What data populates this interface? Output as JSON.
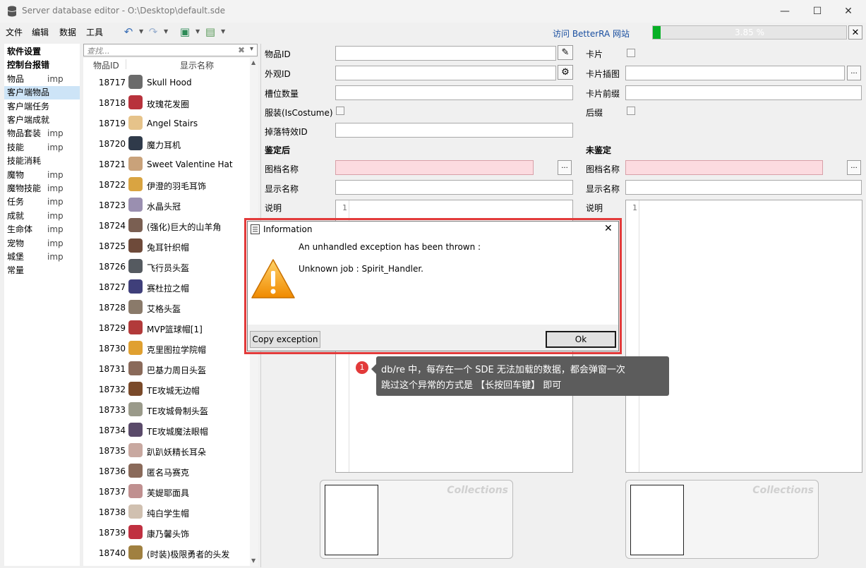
{
  "window": {
    "title": "Server database editor - O:\\Desktop\\default.sde",
    "minimize": "—",
    "maximize": "☐",
    "close": "✕"
  },
  "menu": [
    "文件",
    "编辑",
    "数据",
    "工具"
  ],
  "toolbar": {
    "visit_link": "访问 BetterRA 网站",
    "progress_text": "3.85 %",
    "progress_value": 0.0385,
    "progress_close": "✕"
  },
  "nav": [
    {
      "label": "软件设置",
      "suffix": "",
      "bold": true
    },
    {
      "label": "控制台报错",
      "suffix": "",
      "bold": true
    },
    {
      "label": "物品",
      "suffix": "imp"
    },
    {
      "label": "客户端物品",
      "suffix": "",
      "selected": true
    },
    {
      "label": "客户端任务",
      "suffix": ""
    },
    {
      "label": "客户端成就",
      "suffix": ""
    },
    {
      "label": "物品套装",
      "suffix": "imp"
    },
    {
      "label": "技能",
      "suffix": "imp"
    },
    {
      "label": "技能消耗",
      "suffix": ""
    },
    {
      "label": "魔物",
      "suffix": "imp"
    },
    {
      "label": "魔物技能",
      "suffix": "imp"
    },
    {
      "label": "任务",
      "suffix": "imp"
    },
    {
      "label": "成就",
      "suffix": "imp"
    },
    {
      "label": "生命体",
      "suffix": "imp"
    },
    {
      "label": "宠物",
      "suffix": "imp"
    },
    {
      "label": "城堡",
      "suffix": "imp"
    },
    {
      "label": "常量",
      "suffix": ""
    }
  ],
  "search": {
    "placeholder": "查找...",
    "clear": "✖",
    "drop": "▾"
  },
  "list": {
    "col_id": "物品ID",
    "col_name": "显示名称",
    "rows": [
      {
        "id": "18717",
        "name": "Skull Hood",
        "color": "#6b6b6b"
      },
      {
        "id": "18718",
        "name": "玫瑰花发圈",
        "color": "#b8323c"
      },
      {
        "id": "18719",
        "name": "Angel Stairs",
        "color": "#e6c38a"
      },
      {
        "id": "18720",
        "name": "魔力耳机",
        "color": "#2f3a4a"
      },
      {
        "id": "18721",
        "name": "Sweet Valentine Hat",
        "color": "#c9a27a"
      },
      {
        "id": "18722",
        "name": "伊澄的羽毛耳饰",
        "color": "#d9a441"
      },
      {
        "id": "18723",
        "name": "水晶头冠",
        "color": "#9a8fb0"
      },
      {
        "id": "18724",
        "name": "(强化)巨大的山羊角",
        "color": "#7a5f52"
      },
      {
        "id": "18725",
        "name": "兔耳针织帽",
        "color": "#6e4a3a"
      },
      {
        "id": "18726",
        "name": "飞行员头盔",
        "color": "#555a60"
      },
      {
        "id": "18727",
        "name": "赛杜拉之帽",
        "color": "#3f3f7a"
      },
      {
        "id": "18728",
        "name": "艾格头盔",
        "color": "#8a7a6a"
      },
      {
        "id": "18729",
        "name": "MVP篮球帽[1]",
        "color": "#b23a3a"
      },
      {
        "id": "18730",
        "name": "克里图拉学院帽",
        "color": "#e0a030"
      },
      {
        "id": "18731",
        "name": "巴基力周日头盔",
        "color": "#8a6a5a"
      },
      {
        "id": "18732",
        "name": "TE攻城无边帽",
        "color": "#7a4a2a"
      },
      {
        "id": "18733",
        "name": "TE攻城骨制头盔",
        "color": "#9a9a8a"
      },
      {
        "id": "18734",
        "name": "TE攻城魔法眼帽",
        "color": "#5a4a6a"
      },
      {
        "id": "18735",
        "name": "趴趴妖精长耳朵",
        "color": "#c8a8a0"
      },
      {
        "id": "18736",
        "name": "匿名马赛克",
        "color": "#8a6a5a"
      },
      {
        "id": "18737",
        "name": "芙媞耶面具",
        "color": "#c09090"
      },
      {
        "id": "18738",
        "name": "纯白学生帽",
        "color": "#d0c0b0"
      },
      {
        "id": "18739",
        "name": "康乃馨头饰",
        "color": "#c03040"
      },
      {
        "id": "18740",
        "name": "(时装)极限勇者的头发",
        "color": "#a08040"
      }
    ]
  },
  "form": {
    "item_id": "物品ID",
    "view_id": "外观ID",
    "slots": "槽位数量",
    "is_costume": "服装(IsCostume)",
    "drop_effect": "掉落特效ID",
    "card": "卡片",
    "card_illust": "卡片插图",
    "card_prefix": "卡片前缀",
    "postfix": "后缀",
    "identified": "鉴定后",
    "unidentified": "未鉴定",
    "resource_name": "图档名称",
    "display_name": "显示名称",
    "description": "说明",
    "line_no": "1",
    "ellipsis": "...",
    "collections": "Collections"
  },
  "dialog": {
    "title": "Information",
    "message1": "An unhandled exception has been thrown :",
    "message2": "Unknown job : Spirit_Handler.",
    "copy_button": "Copy exception",
    "ok_button": "Ok",
    "close": "✕"
  },
  "callout": {
    "number": "1",
    "line1": "db/re 中，每存在一个 SDE 无法加载的数据，都会弹窗一次",
    "line2": "跳过这个异常的方式是 【长按回车键】 即可"
  }
}
